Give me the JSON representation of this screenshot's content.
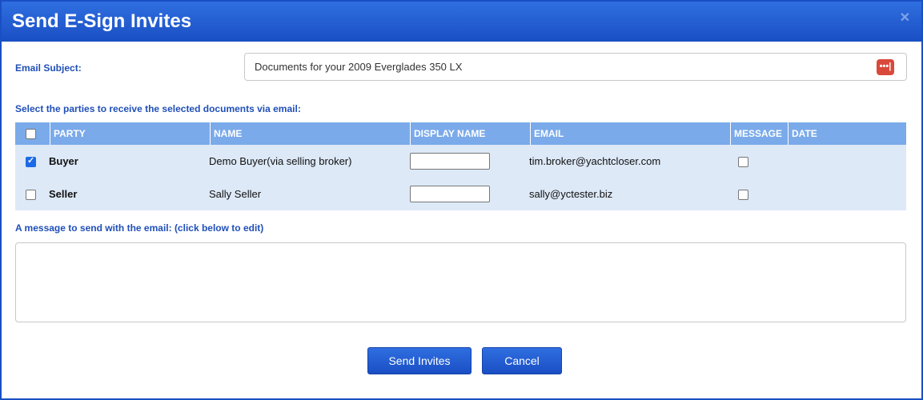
{
  "dialog": {
    "title": "Send E-Sign Invites",
    "close_icon": "close-icon"
  },
  "subject": {
    "label": "Email Subject:",
    "value": "Documents for your 2009 Everglades 350 LX",
    "addon_icon": "password-manager-icon",
    "addon_text": "•••|"
  },
  "parties": {
    "label": "Select the parties to receive the selected documents via email:",
    "columns": [
      "PARTY",
      "NAME",
      "DISPLAY NAME",
      "EMAIL",
      "MESSAGE",
      "DATE"
    ],
    "select_all_checked": false,
    "rows": [
      {
        "checked": true,
        "party": "Buyer",
        "name": "Demo Buyer(via selling broker)",
        "display_name": "",
        "email": "tim.broker@yachtcloser.com",
        "message": false,
        "date": ""
      },
      {
        "checked": false,
        "party": "Seller",
        "name": "Sally Seller",
        "display_name": "",
        "email": "sally@yctester.biz",
        "message": false,
        "date": ""
      }
    ]
  },
  "message": {
    "label": "A message to send with the email: (click below to edit)",
    "value": ""
  },
  "buttons": {
    "send": "Send Invites",
    "cancel": "Cancel"
  },
  "colors": {
    "titlebar": "#1a4fc4",
    "header": "#7aaaea",
    "row": "#dde9f7",
    "label": "#1f4fb8"
  }
}
